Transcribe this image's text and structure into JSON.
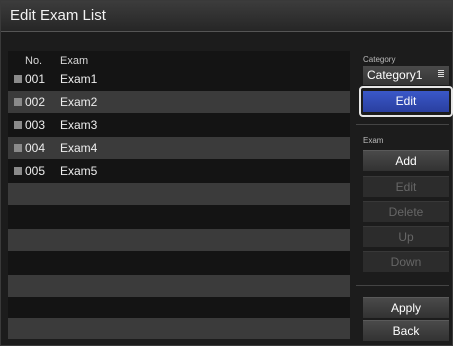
{
  "window": {
    "title": "Edit Exam List"
  },
  "list": {
    "headers": {
      "no": "No.",
      "exam": "Exam"
    },
    "rows": [
      {
        "no": "001",
        "exam": "Exam1"
      },
      {
        "no": "002",
        "exam": "Exam2"
      },
      {
        "no": "003",
        "exam": "Exam3"
      },
      {
        "no": "004",
        "exam": "Exam4"
      },
      {
        "no": "005",
        "exam": "Exam5"
      }
    ]
  },
  "category": {
    "label": "Category",
    "selected": "Category1",
    "edit_label": "Edit",
    "menu_icon": "list-icon"
  },
  "exam_panel": {
    "label": "Exam",
    "add": "Add",
    "edit": "Edit",
    "delete": "Delete",
    "up": "Up",
    "down": "Down"
  },
  "actions": {
    "apply": "Apply",
    "back": "Back"
  },
  "colors": {
    "accent": "#2f4fb8",
    "row_shade": "#3b3b3b",
    "background": "#1c1c1c"
  }
}
